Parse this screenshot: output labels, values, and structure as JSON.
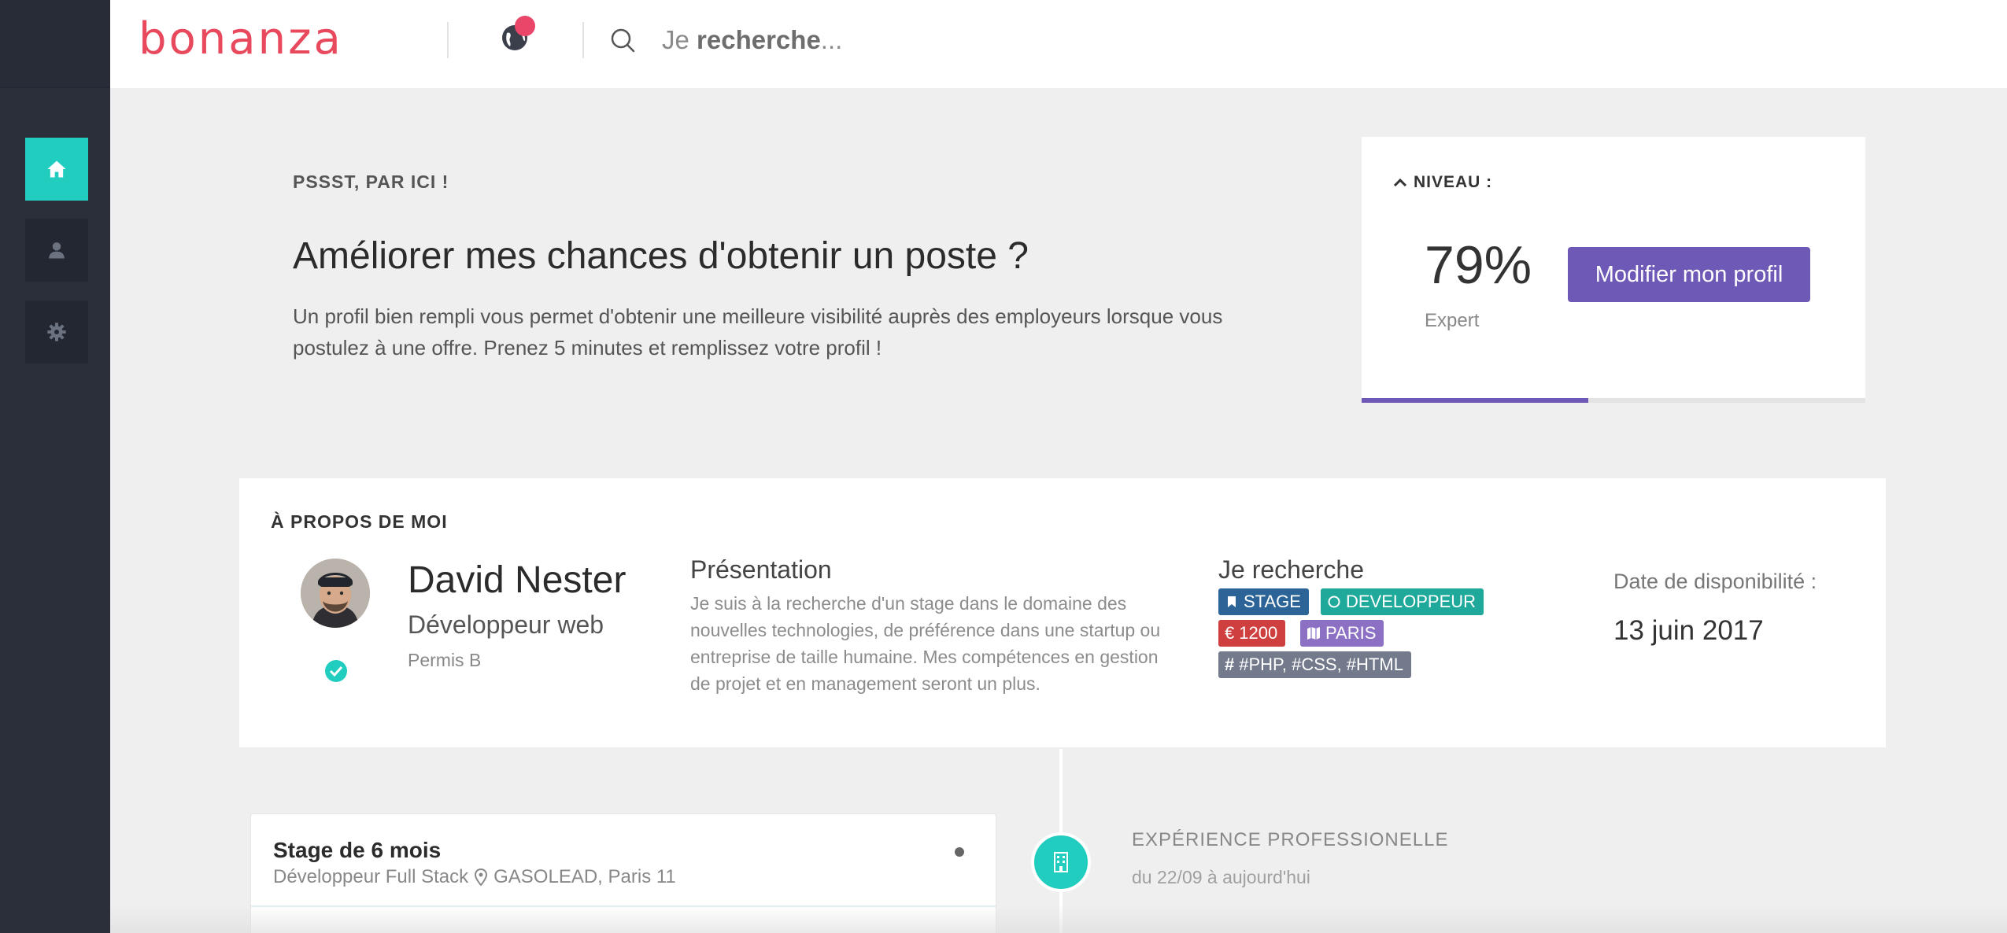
{
  "header": {
    "logo": "bonanza",
    "search_placeholder_prefix": "Je ",
    "search_placeholder_bold": "recherche",
    "search_placeholder_suffix": "..."
  },
  "sidebar": {
    "items": [
      {
        "icon": "home-icon",
        "active": true
      },
      {
        "icon": "user-icon",
        "active": false
      },
      {
        "icon": "gear-icon",
        "active": false
      }
    ]
  },
  "promo": {
    "eyebrow": "PSSST, PAR ICI !",
    "title": "Améliorer mes chances d'obtenir un poste ?",
    "text": "Un profil bien rempli vous permet d'obtenir une meilleure visibilité auprès des employeurs lorsque vous postulez à une offre. Prenez 5 minutes et remplissez votre profil !"
  },
  "level": {
    "label": "NIVEAU :",
    "percent_text": "79%",
    "rank": "Expert",
    "button": "Modifier mon profil",
    "progress_fraction": 0.45
  },
  "about": {
    "title": "À PROPOS DE MOI",
    "name": "David Nester",
    "role": "Développeur web",
    "permit": "Permis B",
    "presentation_title": "Présentation",
    "presentation_text": "Je suis à la recherche d'un stage dans le domaine des nouvelles technologies, de préférence dans une startup ou entreprise de taille humaine. Mes compétences en gestion de projet et en management seront un plus.",
    "seeking_title": "Je recherche",
    "tags": [
      {
        "label": "STAGE",
        "icon": "bookmark-icon",
        "color": "#2d6497"
      },
      {
        "label": "DEVELOPPEUR",
        "icon": "circle-icon",
        "color": "#1fa99a"
      },
      {
        "label": "1200",
        "icon": "euro-icon",
        "color": "#cf3f3f"
      },
      {
        "label": "PARIS",
        "icon": "map-icon",
        "color": "#8c70c4"
      },
      {
        "label": "#PHP, #CSS, #HTML",
        "icon": "hash-icon",
        "color": "#737a8c"
      }
    ],
    "availability_label": "Date de disponibilité :",
    "availability_date": "13 juin 2017"
  },
  "experience": {
    "card_title": "Stage de 6 mois",
    "card_role": "Développeur Full Stack",
    "card_company": "GASOLEAD, Paris 11",
    "section_label": "EXPÉRIENCE PROFESSIONELLE",
    "section_dates": "du 22/09 à aujourd'hui"
  },
  "colors": {
    "accent_teal": "#20cdbf",
    "accent_purple": "#6f59b6",
    "brand_red": "#e8495d",
    "sidebar": "#2b2f3a"
  }
}
